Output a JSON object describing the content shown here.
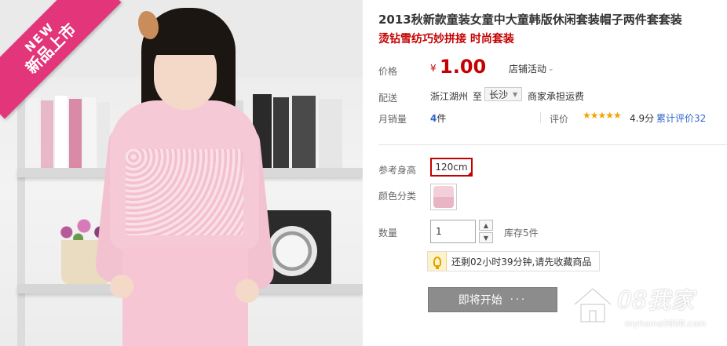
{
  "badge": {
    "en": "NEW",
    "cn": "新品上市"
  },
  "product": {
    "title": "2013秋新款童装女童中大童韩版休闲套装帽子两件套套装",
    "subtitle": "烫钻雪纺巧妙拼接 时尚套装"
  },
  "price": {
    "label": "价格",
    "currency": "¥",
    "value": "1.00",
    "promo": "店铺活动"
  },
  "shipping": {
    "label": "配送",
    "from": "浙江湖州",
    "to_word": "至",
    "city": "长沙",
    "fee": "商家承担运费"
  },
  "sales": {
    "label": "月销量",
    "count": "4",
    "unit": "件"
  },
  "rating": {
    "label": "评价",
    "stars": "★★★★★",
    "score": "4.9分",
    "reviews": "累计评价32"
  },
  "size": {
    "label": "参考身高",
    "selected": "120cm"
  },
  "color": {
    "label": "颜色分类"
  },
  "quantity": {
    "label": "数量",
    "value": "1",
    "stock": "库存5件"
  },
  "tip": {
    "text": "还剩02小时39分钟,请先收藏商品"
  },
  "action": {
    "start_label": "即将开始",
    "dots": "···"
  },
  "watermark": {
    "text": "08我家",
    "url": "myhome0808.com"
  },
  "colors": {
    "accent": "#c40000",
    "link": "#3366cc",
    "badge": "#e3357a",
    "button_disabled": "#8c8c8c"
  }
}
